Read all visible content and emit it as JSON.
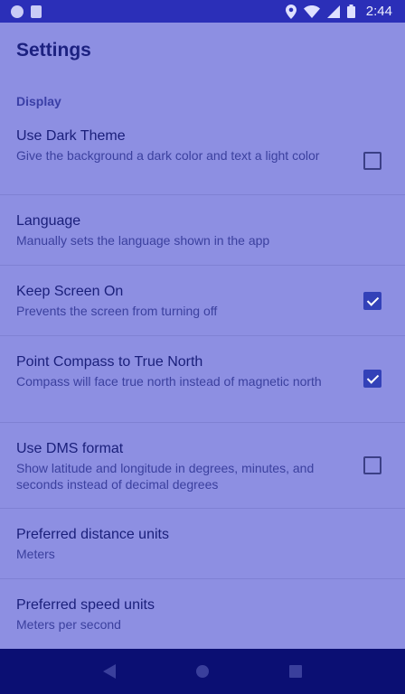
{
  "status_bar": {
    "time": "2:44",
    "icons": [
      "notification-dot-icon",
      "sd-card-icon",
      "location-icon",
      "wifi-icon",
      "signal-icon",
      "battery-icon"
    ]
  },
  "toolbar": {
    "title": "Settings"
  },
  "categories": [
    {
      "title": "Display",
      "preferences": [
        {
          "title": "Use Dark Theme",
          "summary": "Give the background a dark color and text a light color",
          "checked": false
        },
        {
          "title": "Language",
          "summary": "Manually sets the language shown in the app"
        },
        {
          "title": "Keep Screen On",
          "summary": "Prevents the screen from turning off",
          "checked": true
        },
        {
          "title": "Point Compass to True North",
          "summary": "Compass will face true north instead of magnetic north",
          "checked": true
        },
        {
          "title": "Use DMS format",
          "summary": "Show latitude and longitude in degrees, minutes, and seconds instead of decimal degrees",
          "checked": false
        },
        {
          "title": "Preferred distance units",
          "summary": "Meters"
        },
        {
          "title": "Preferred speed units",
          "summary": "Meters per second"
        }
      ]
    }
  ],
  "nav_bar": {
    "icons": [
      "back-icon",
      "home-icon",
      "recents-icon"
    ]
  },
  "colors": {
    "status_bar": "#2b2fb8",
    "background": "#8d8fe2",
    "nav_bar": "#0b0f73",
    "accent": "#3341b8"
  }
}
